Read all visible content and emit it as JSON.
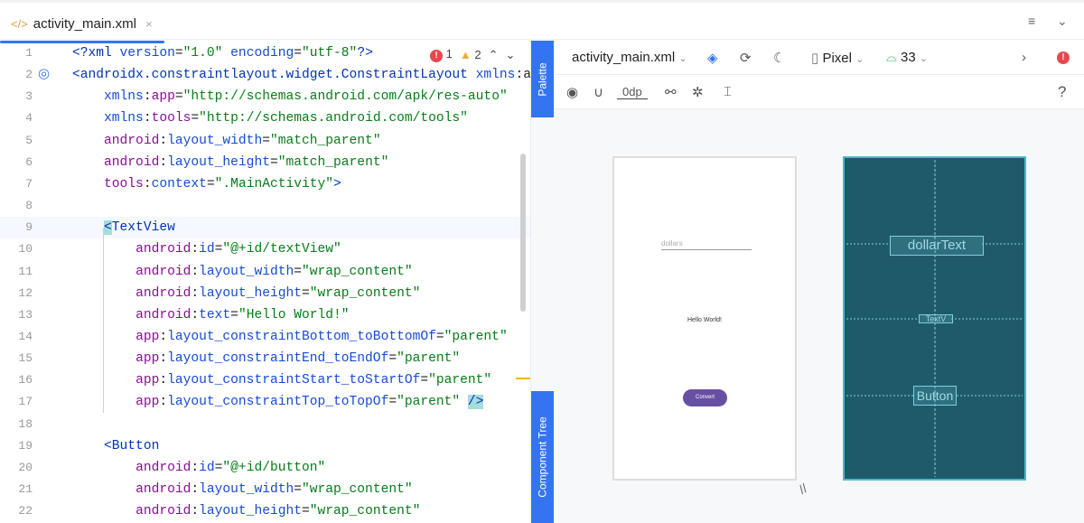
{
  "tab": {
    "icon": "xml-code-icon",
    "title": "activity_main.xml",
    "close": "×"
  },
  "tabbar_right": {
    "menu": "≡",
    "chevron": "⌄"
  },
  "inspections": {
    "errors": "1",
    "warnings": "2"
  },
  "editor": {
    "lines": [
      [
        [
          "t-tag",
          "<?xml "
        ],
        [
          "t-attr",
          "version"
        ],
        [
          "t-p",
          "="
        ],
        [
          "t-val",
          "\"1.0\""
        ],
        [
          "t-attr",
          " encoding"
        ],
        [
          "t-p",
          "="
        ],
        [
          "t-val",
          "\"utf-8\""
        ],
        [
          "t-tag",
          "?>"
        ]
      ],
      [
        [
          "t-tag",
          "<androidx.constraintlayout.widget.ConstraintLayout "
        ],
        [
          "t-attr",
          "xmlns"
        ],
        [
          "t-p",
          ":a"
        ]
      ],
      [
        [
          "t-p",
          "    "
        ],
        [
          "t-attr",
          "xmlns"
        ],
        [
          "t-p",
          ":"
        ],
        [
          "t-ns",
          "app"
        ],
        [
          "t-p",
          "="
        ],
        [
          "t-val",
          "\"http://schemas.android.com/apk/res-auto\""
        ]
      ],
      [
        [
          "t-p",
          "    "
        ],
        [
          "t-attr",
          "xmlns"
        ],
        [
          "t-p",
          ":"
        ],
        [
          "t-ns",
          "tools"
        ],
        [
          "t-p",
          "="
        ],
        [
          "t-val",
          "\"http://schemas.android.com/tools\""
        ]
      ],
      [
        [
          "t-p",
          "    "
        ],
        [
          "t-ns",
          "android"
        ],
        [
          "t-p",
          ":"
        ],
        [
          "t-attr",
          "layout_width"
        ],
        [
          "t-p",
          "="
        ],
        [
          "t-val",
          "\"match_parent\""
        ]
      ],
      [
        [
          "t-p",
          "    "
        ],
        [
          "t-ns",
          "android"
        ],
        [
          "t-p",
          ":"
        ],
        [
          "t-attr",
          "layout_height"
        ],
        [
          "t-p",
          "="
        ],
        [
          "t-val",
          "\"match_parent\""
        ]
      ],
      [
        [
          "t-p",
          "    "
        ],
        [
          "t-ns",
          "tools"
        ],
        [
          "t-p",
          ":"
        ],
        [
          "t-attr",
          "context"
        ],
        [
          "t-p",
          "="
        ],
        [
          "t-val",
          "\".MainActivity\""
        ],
        [
          "t-tag",
          ">"
        ]
      ],
      [],
      [
        [
          "t-p",
          "    "
        ],
        [
          "t-sel",
          "<"
        ],
        [
          "t-tag",
          "TextView"
        ]
      ],
      [
        [
          "t-p",
          "        "
        ],
        [
          "t-ns",
          "android"
        ],
        [
          "t-p",
          ":"
        ],
        [
          "t-attr",
          "id"
        ],
        [
          "t-p",
          "="
        ],
        [
          "t-val",
          "\"@+id/textView\""
        ]
      ],
      [
        [
          "t-p",
          "        "
        ],
        [
          "t-ns",
          "android"
        ],
        [
          "t-p",
          ":"
        ],
        [
          "t-attr",
          "layout_width"
        ],
        [
          "t-p",
          "="
        ],
        [
          "t-val",
          "\"wrap_content\""
        ]
      ],
      [
        [
          "t-p",
          "        "
        ],
        [
          "t-ns",
          "android"
        ],
        [
          "t-p",
          ":"
        ],
        [
          "t-attr",
          "layout_height"
        ],
        [
          "t-p",
          "="
        ],
        [
          "t-val",
          "\"wrap_content\""
        ]
      ],
      [
        [
          "t-p",
          "        "
        ],
        [
          "t-ns",
          "android"
        ],
        [
          "t-p",
          ":"
        ],
        [
          "t-attr",
          "text"
        ],
        [
          "t-p",
          "="
        ],
        [
          "t-val",
          "\"Hello World!\""
        ]
      ],
      [
        [
          "t-p",
          "        "
        ],
        [
          "t-ns",
          "app"
        ],
        [
          "t-p",
          ":"
        ],
        [
          "t-attr",
          "layout_constraintBottom_toBottomOf"
        ],
        [
          "t-p",
          "="
        ],
        [
          "t-val",
          "\"parent\""
        ]
      ],
      [
        [
          "t-p",
          "        "
        ],
        [
          "t-ns",
          "app"
        ],
        [
          "t-p",
          ":"
        ],
        [
          "t-attr",
          "layout_constraintEnd_toEndOf"
        ],
        [
          "t-p",
          "="
        ],
        [
          "t-val",
          "\"parent\""
        ]
      ],
      [
        [
          "t-p",
          "        "
        ],
        [
          "t-ns",
          "app"
        ],
        [
          "t-p",
          ":"
        ],
        [
          "t-attr",
          "layout_constraintStart_toStartOf"
        ],
        [
          "t-p",
          "="
        ],
        [
          "t-val",
          "\"parent\""
        ]
      ],
      [
        [
          "t-p",
          "        "
        ],
        [
          "t-ns",
          "app"
        ],
        [
          "t-p",
          ":"
        ],
        [
          "t-attr",
          "layout_constraintTop_toTopOf"
        ],
        [
          "t-p",
          "="
        ],
        [
          "t-val",
          "\"parent\""
        ],
        [
          "t-p",
          " "
        ],
        [
          "t-sel",
          "/>"
        ]
      ],
      [],
      [
        [
          "t-p",
          "    "
        ],
        [
          "t-tag",
          "<Button"
        ]
      ],
      [
        [
          "t-p",
          "        "
        ],
        [
          "t-ns",
          "android"
        ],
        [
          "t-p",
          ":"
        ],
        [
          "t-attr",
          "id"
        ],
        [
          "t-p",
          "="
        ],
        [
          "t-val",
          "\"@+id/button\""
        ]
      ],
      [
        [
          "t-p",
          "        "
        ],
        [
          "t-ns",
          "android"
        ],
        [
          "t-p",
          ":"
        ],
        [
          "t-attr",
          "layout_width"
        ],
        [
          "t-p",
          "="
        ],
        [
          "t-val",
          "\"wrap_content\""
        ]
      ],
      [
        [
          "t-p",
          "        "
        ],
        [
          "t-ns",
          "android"
        ],
        [
          "t-p",
          ":"
        ],
        [
          "t-attr",
          "layout_height"
        ],
        [
          "t-p",
          "="
        ],
        [
          "t-val",
          "\"wrap_content\""
        ]
      ]
    ],
    "highlight_line": 9
  },
  "side_tabs": {
    "palette": "Palette",
    "component_tree": "Component Tree"
  },
  "design_toolbar": {
    "file": "activity_main.xml",
    "device": "Pixel",
    "api": "33",
    "margin": "0dp",
    "help": "?"
  },
  "preview": {
    "field_hint": "dollars",
    "text": "Hello World!",
    "button": "Convert"
  },
  "blueprint": {
    "edit": "dollarText",
    "text": "TextV",
    "button": "Button"
  },
  "colors": {
    "accent": "#3574f0",
    "blueprint": "#1f5a6b",
    "button": "#6750a4"
  }
}
